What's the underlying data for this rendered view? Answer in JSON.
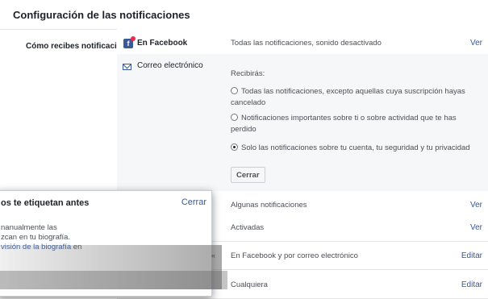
{
  "header": {
    "title": "Configuración de las notificaciones"
  },
  "settings": {
    "row_label": "Cómo recibes notificaciones",
    "facebook": {
      "icon": "facebook-notifications-icon",
      "label": "En Facebook",
      "value": "Todas las notificaciones, sonido desactivado",
      "action": "Ver"
    },
    "email": {
      "icon": "envelope-icon",
      "label": "Correo electrónico",
      "receive_label": "Recibirás:",
      "options": [
        {
          "label": "Todas las notificaciones, excepto aquellas cuya suscripción hayas cancelado",
          "selected": false
        },
        {
          "label": "Notificaciones importantes sobre ti o sobre actividad que te has perdido",
          "selected": false
        },
        {
          "label": "Solo las notificaciones sobre tu cuenta, tu seguridad y tu privacidad",
          "selected": true
        }
      ],
      "close_button": "Cerrar"
    }
  },
  "rows": [
    {
      "value": "Algunas notificaciones",
      "action": "Ver"
    },
    {
      "value": "Activadas",
      "action": "Ver"
    },
    {
      "value": "En Facebook y por correo electrónico",
      "action": "Editar"
    },
    {
      "value": "Cualquiera",
      "action": "Editar"
    }
  ],
  "popover": {
    "title": "os te etiquetan antes",
    "close": "Cerrar",
    "line1": "nanualmente las",
    "line2": "zcan en tu biografía.",
    "link": "visión de la biografía",
    "line3_suffix": " en"
  },
  "colors": {
    "link": "#365899",
    "text": "#1d2129",
    "muted": "#4b4f56",
    "panel": "#f6f7f9",
    "border": "#e5e5e5"
  }
}
